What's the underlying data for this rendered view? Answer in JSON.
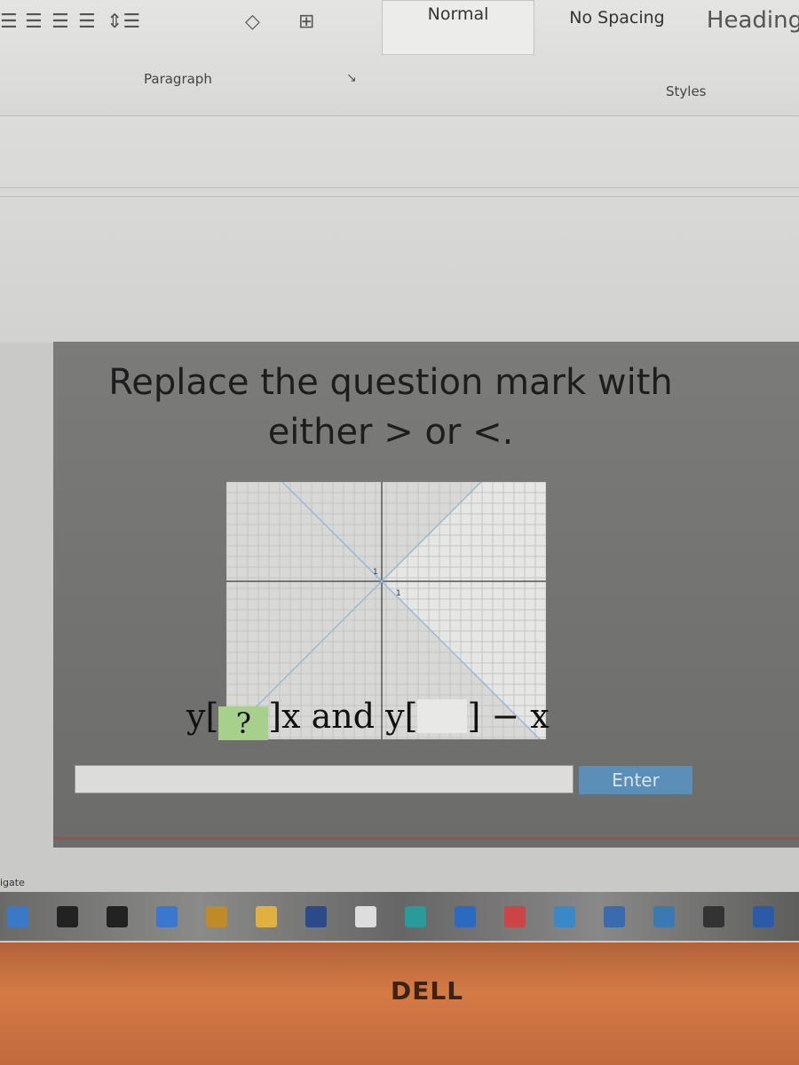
{
  "ribbon": {
    "styles": [
      "Normal",
      "No Spacing",
      "Heading"
    ],
    "paragraph_label": "Paragraph",
    "styles_label": "Styles"
  },
  "question": {
    "text": "Replace the question mark with either > or <.",
    "expr": {
      "y1": "y[",
      "box1": "?",
      "after1": "]x and y[",
      "after2": "] − x"
    },
    "enter_label": "Enter",
    "answer_value": ""
  },
  "chart_data": {
    "type": "line",
    "series": [
      {
        "equation": "y = x",
        "points": [
          [
            -5,
            -5
          ],
          [
            5,
            5
          ]
        ]
      },
      {
        "equation": "y = -x",
        "points": [
          [
            -5,
            5
          ],
          [
            5,
            -5
          ]
        ]
      }
    ],
    "tick_labels": [
      "1",
      "1"
    ],
    "grid": true,
    "line_color": "#9ab8d8"
  },
  "taskbar": {
    "nav_label": "igate",
    "icons": [
      "windows-icon",
      "search-icon",
      "task-view-icon",
      "chat-icon",
      "app-icon",
      "file-explorer-icon",
      "store-icon",
      "dell-icon",
      "app-icon",
      "edge-icon",
      "app-icon",
      "mail-icon",
      "app-icon",
      "app-icon",
      "amazon-icon",
      "word-icon"
    ],
    "brand": "DELL"
  }
}
